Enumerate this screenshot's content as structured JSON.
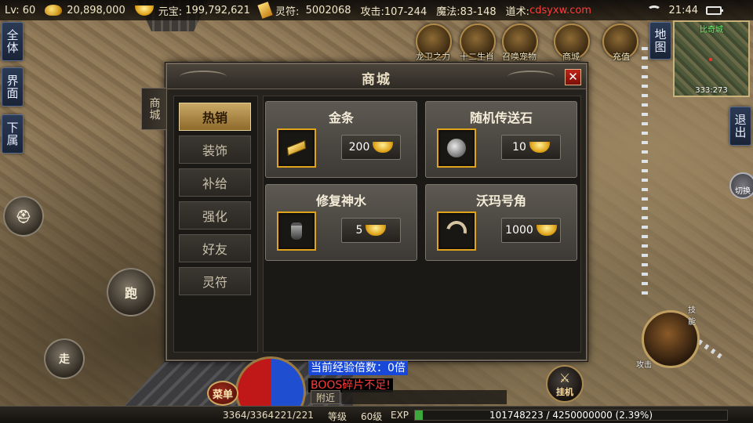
{
  "status_bar": {
    "level": "Lv: 60",
    "gold": "20,898,000",
    "yuanbao_label": "元宝:",
    "yuanbao_value": "199,792,621",
    "talisman_label": "灵符:",
    "talisman_value": "5002068",
    "attack": "攻击:107-244",
    "magic": "魔法:83-148",
    "taoism": "道术:",
    "watermark": "cdsyxw.com",
    "time": "21:44"
  },
  "side_buttons": {
    "all": "全体",
    "ui": "界面",
    "subordinate": "下属",
    "map": "地图",
    "exit": "退出"
  },
  "top_icons": [
    {
      "label": "龙卫之力",
      "icon": "dragon-guard-icon"
    },
    {
      "label": "十二生肖",
      "icon": "zodiac-icon"
    },
    {
      "label": "召唤宠物",
      "icon": "summon-pet-icon"
    },
    {
      "label": "商城",
      "icon": "shop-icon"
    },
    {
      "label": "充值",
      "icon": "recharge-icon"
    }
  ],
  "minimap": {
    "name": "比奇城",
    "coords": "333:273"
  },
  "controls": {
    "run": "跑",
    "walk": "走",
    "switch": "切换",
    "afk": "挂机",
    "menu": "菜单"
  },
  "shop": {
    "title": "商城",
    "side_tab": "商城",
    "close": "✕",
    "categories": [
      {
        "label": "热销",
        "active": true
      },
      {
        "label": "装饰",
        "active": false
      },
      {
        "label": "补给",
        "active": false
      },
      {
        "label": "强化",
        "active": false
      },
      {
        "label": "好友",
        "active": false
      },
      {
        "label": "灵符",
        "active": false
      }
    ],
    "items": [
      {
        "name": "金条",
        "price": "200",
        "icon": "gold-bar-icon"
      },
      {
        "name": "随机传送石",
        "price": "10",
        "icon": "teleport-stone-icon"
      },
      {
        "name": "修复神水",
        "price": "5",
        "icon": "repair-potion-icon"
      },
      {
        "name": "沃玛号角",
        "price": "1000",
        "icon": "woma-horn-icon"
      }
    ]
  },
  "chat": {
    "exp_line": "当前经验倍数：0倍",
    "boss_line": "BOOS碎片不足!",
    "tab_near": "附近"
  },
  "bottom_bar": {
    "hp": "3364/3364",
    "mp": "221/221",
    "level_label": "等级",
    "level_value": "60级",
    "exp_label": "EXP",
    "exp_text": "101748223 / 4250000000 (2.39%)",
    "exp_fraction": 0.0239
  },
  "colors": {
    "accent_gold": "#e0a31c",
    "exp_bg": "#1848d8",
    "boss_red": "#ff3a3a",
    "close_red": "#c02418"
  }
}
